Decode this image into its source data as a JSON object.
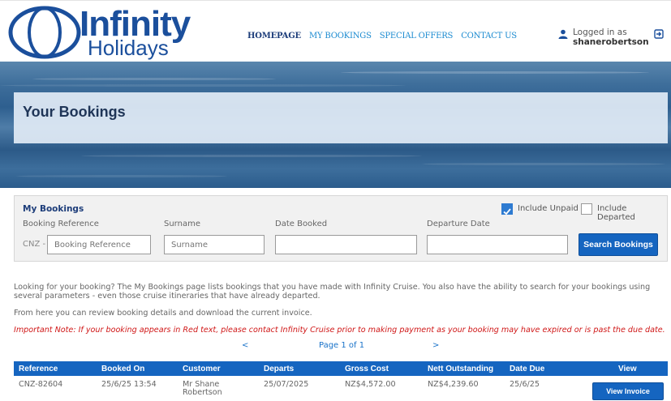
{
  "brand": {
    "name_top": "Infinity",
    "name_bottom": "Holidays"
  },
  "nav": {
    "items": [
      "HOMEPAGE",
      "MY BOOKINGS",
      "SPECIAL OFFERS",
      "CONTACT US"
    ],
    "active": "HOMEPAGE"
  },
  "user": {
    "logged_in_label": "Logged in as",
    "username": "shanerobertson"
  },
  "banner": {
    "title": "Your Bookings"
  },
  "search": {
    "title": "My Bookings",
    "include_unpaid_label": "Include Unpaid",
    "include_unpaid_checked": true,
    "include_departed_label": "Include Departed",
    "include_departed_checked": false,
    "booking_reference_label": "Booking Reference",
    "surname_label": "Surname",
    "date_booked_label": "Date Booked",
    "departure_date_label": "Departure Date",
    "reference_prefix": "CNZ -",
    "booking_reference_placeholder": "Booking Reference",
    "surname_placeholder": "Surname",
    "button_label": "Search Bookings"
  },
  "info": {
    "line1": "Looking for your booking? The My Bookings page lists bookings that you have made with Infinity Cruise. You also have the ability to search for your bookings using several parameters - even those cruise itineraries that have already departed.",
    "line2": "From here you can review booking details and download the current invoice.",
    "important": "Important Note: If your booking appears in Red text, please contact Infinity Cruise prior to making payment as your booking may have expired or is past the due date."
  },
  "pager": {
    "prev": "<",
    "label": "Page 1 of 1",
    "next": ">"
  },
  "table": {
    "headers": [
      "Reference",
      "Booked On",
      "Customer",
      "Departs",
      "Gross Cost",
      "Nett Outstanding",
      "Date Due",
      "View"
    ],
    "rows": [
      {
        "reference": "CNZ-82604",
        "booked_on": "25/6/25 13:54",
        "customer_line1": "Mr Shane",
        "customer_line2": "Robertson",
        "departs": "25/07/2025",
        "gross_cost": "NZ$4,572.00",
        "nett_outstanding": "NZ$4,239.60",
        "date_due": "25/6/25",
        "action": "View Invoice"
      }
    ]
  },
  "colors": {
    "brand_blue": "#1b4f9c",
    "nav_link": "#1a8ad0",
    "primary_button": "#1565c0",
    "important_text": "#d01818"
  }
}
